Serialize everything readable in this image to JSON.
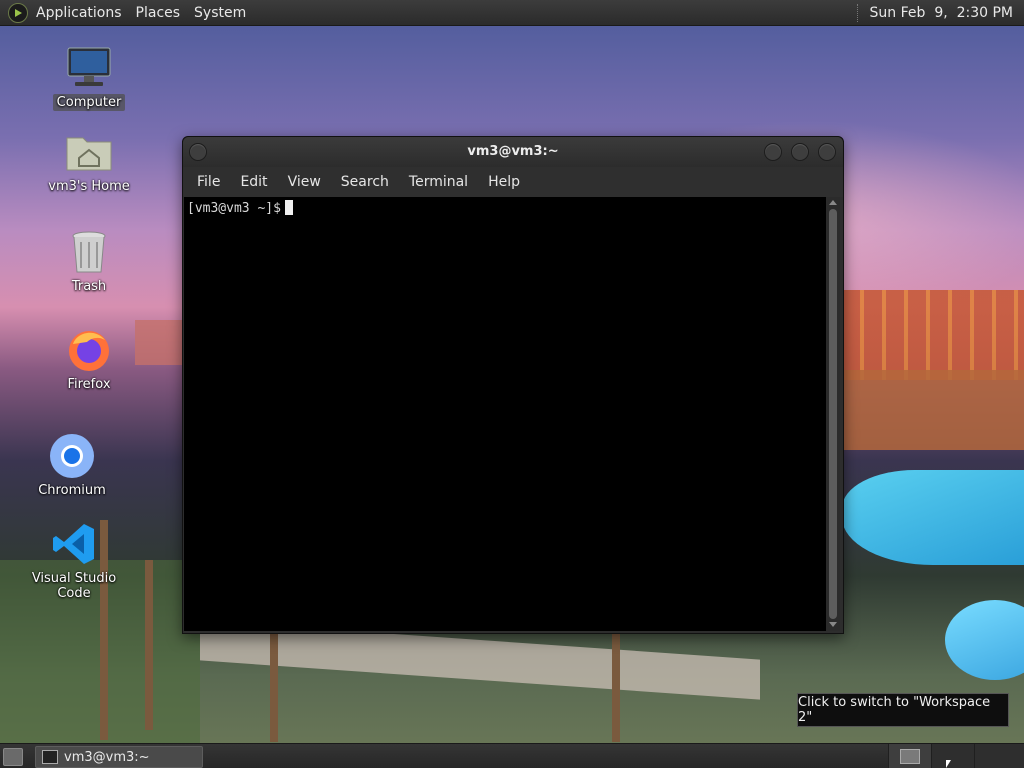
{
  "top_panel": {
    "menus": [
      "Applications",
      "Places",
      "System"
    ],
    "clock": "Sun Feb  9,  2:30 PM"
  },
  "desktop_icons": {
    "computer": "Computer",
    "home": "vm3's Home",
    "trash": "Trash",
    "firefox": "Firefox",
    "chromium": "Chromium",
    "vscode": "Visual Studio Code"
  },
  "terminal": {
    "title": "vm3@vm3:~",
    "menus": [
      "File",
      "Edit",
      "View",
      "Search",
      "Terminal",
      "Help"
    ],
    "prompt": "[vm3@vm3 ~]$"
  },
  "taskbar": {
    "task_label": "vm3@vm3:~",
    "tooltip": "Click to switch to \"Workspace 2\""
  }
}
